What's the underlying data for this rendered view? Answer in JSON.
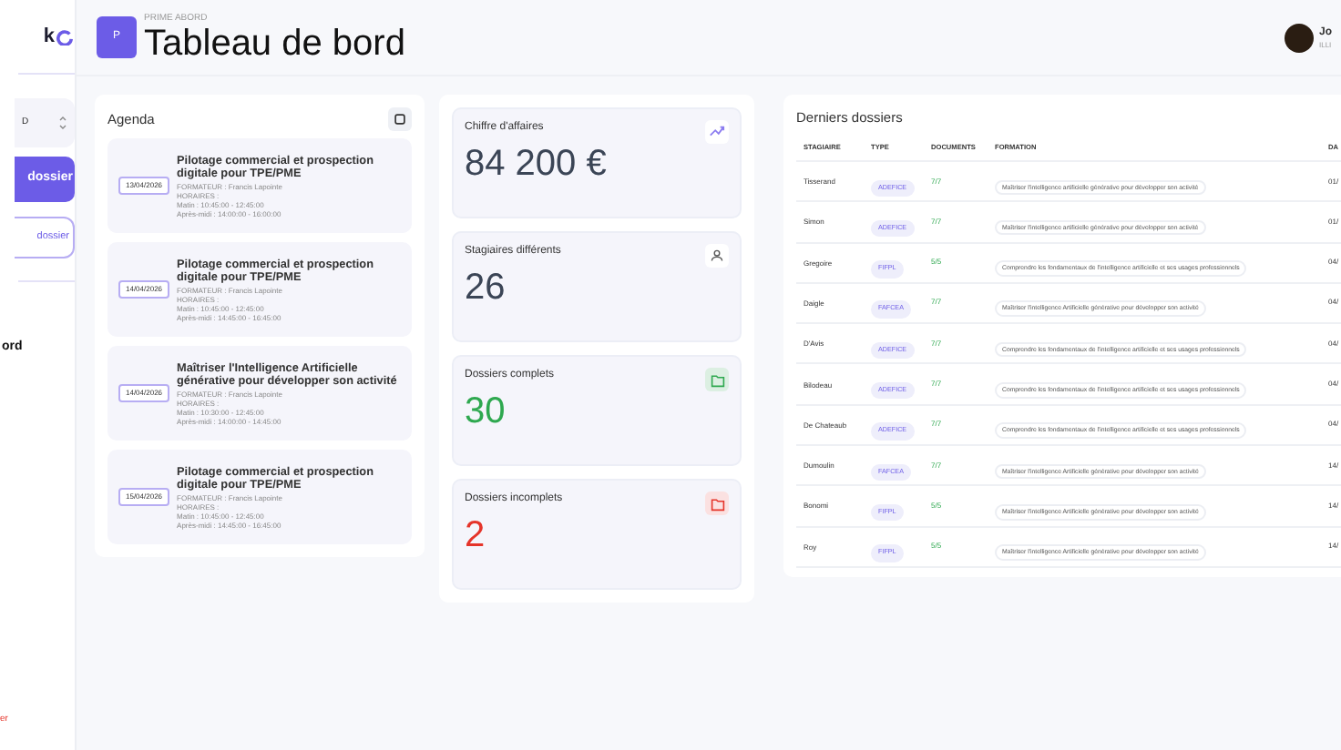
{
  "sidebar": {
    "logo": "k",
    "select": {
      "value": "D"
    },
    "primary_button": "dossier",
    "secondary_button": "dossier",
    "nav_items": [
      {
        "label": "ord",
        "selected": true
      }
    ],
    "logout": "er"
  },
  "header": {
    "badge": "P",
    "subtitle": "PRIME ABORD",
    "title": "Tableau de bord",
    "user": {
      "name": "Jo",
      "role": "ILLI"
    }
  },
  "agenda": {
    "title": "Agenda",
    "items": [
      {
        "date": "13/04/2026",
        "title": "Pilotage commercial et prospection digitale pour TPE/PME",
        "lines": [
          "FORMATEUR : Francis Lapointe",
          "HORAIRES :",
          "Matin : 10:45:00 - 12:45:00",
          "Après-midi : 14:00:00 - 16:00:00"
        ]
      },
      {
        "date": "14/04/2026",
        "title": "Pilotage commercial et prospection digitale pour TPE/PME",
        "lines": [
          "FORMATEUR : Francis Lapointe",
          "HORAIRES :",
          "Matin : 10:45:00 - 12:45:00",
          "Après-midi : 14:45:00 - 16:45:00"
        ]
      },
      {
        "date": "14/04/2026",
        "title": "Maîtriser l'Intelligence Artificielle générative pour développer son activité",
        "lines": [
          "FORMATEUR : Francis Lapointe",
          "HORAIRES :",
          "Matin : 10:30:00 - 12:45:00",
          "Après-midi : 14:00:00 - 14:45:00"
        ]
      },
      {
        "date": "15/04/2026",
        "title": "Pilotage commercial et prospection digitale pour TPE/PME",
        "lines": [
          "FORMATEUR : Francis Lapointe",
          "HORAIRES :",
          "Matin : 10:45:00 - 12:45:00",
          "Après-midi : 14:45:00 - 16:45:00"
        ]
      }
    ]
  },
  "stats": [
    {
      "label": "Chiffre d'affaires",
      "value": "84 200 €",
      "kind": "revenue",
      "color": "#3b4556"
    },
    {
      "label": "Stagiaires différents",
      "value": "26",
      "kind": "people",
      "color": "#3b4556"
    },
    {
      "label": "Dossiers complets",
      "value": "30",
      "kind": "complete",
      "color": "#2ea84f"
    },
    {
      "label": "Dossiers incomplets",
      "value": "2",
      "kind": "incomplete",
      "color": "#e5342a"
    }
  ],
  "table": {
    "title": "Derniers dossiers",
    "columns": [
      "STAGIAIRE",
      "TYPE",
      "DOCUMENTS",
      "FORMATION",
      "DA"
    ],
    "rows": [
      {
        "stagiaire": "Tisserand",
        "type": "ADEFICE",
        "documents": "7/7",
        "formation": "Maîtriser l'intelligence artificielle générative pour développer son activité",
        "date": "01/"
      },
      {
        "stagiaire": "Simon",
        "type": "ADEFICE",
        "documents": "7/7",
        "formation": "Maîtriser l'intelligence artificielle générative pour développer son activité",
        "date": "01/"
      },
      {
        "stagiaire": "Gregoire",
        "type": "FIFPL",
        "documents": "5/5",
        "formation": "Comprendre les fondamentaux de l'intelligence artificielle et ses usages professionnels",
        "date": "04/"
      },
      {
        "stagiaire": "Daigle",
        "type": "FAFCEA",
        "documents": "7/7",
        "formation": "Maîtriser l'intelligence Artificielle générative pour développer son activité",
        "date": "04/"
      },
      {
        "stagiaire": "D'Avis",
        "type": "ADEFICE",
        "documents": "7/7",
        "formation": "Comprendre les fondamentaux de l'intelligence artificielle et ses usages professionnels",
        "date": "04/"
      },
      {
        "stagiaire": "Bilodeau",
        "type": "ADEFICE",
        "documents": "7/7",
        "formation": "Comprendre les fondamentaux de l'intelligence artificielle et ses usages professionnels",
        "date": "04/"
      },
      {
        "stagiaire": "De Chateaub",
        "type": "ADEFICE",
        "documents": "7/7",
        "formation": "Comprendre les fondamentaux de l'intelligence artificielle et ses usages professionnels",
        "date": "04/"
      },
      {
        "stagiaire": "Dumoulin",
        "type": "FAFCEA",
        "documents": "7/7",
        "formation": "Maîtriser l'intelligence Artificielle générative pour développer son activité",
        "date": "14/"
      },
      {
        "stagiaire": "Bonomi",
        "type": "FIFPL",
        "documents": "5/5",
        "formation": "Maîtriser l'intelligence Artificielle générative pour développer son activité",
        "date": "14/"
      },
      {
        "stagiaire": "Roy",
        "type": "FIFPL",
        "documents": "5/5",
        "formation": "Maîtriser l'intelligence Artificielle générative pour développer son activité",
        "date": "14/"
      }
    ]
  }
}
